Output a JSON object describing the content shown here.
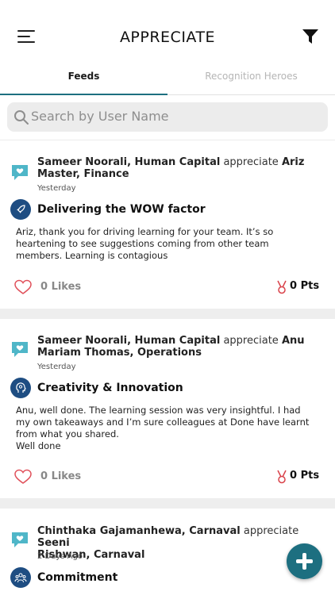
{
  "header": {
    "title": "APPRECIATE",
    "menu_icon": "hamburger-menu-icon",
    "filter_icon": "filter-funnel-icon"
  },
  "tabs": [
    {
      "label": "Feeds",
      "active": true
    },
    {
      "label": "Recognition Heroes",
      "active": false
    }
  ],
  "search": {
    "placeholder": "Search by User Name",
    "value": ""
  },
  "colors": {
    "accent": "#1d6f80",
    "badge": "#1e4d82",
    "message_icon": "#4fb6c8",
    "heart": "#e0505a",
    "medal": "#d9424a"
  },
  "feeds": [
    {
      "from": "Sameer Noorali, Human Capital",
      "verb": "appreciate",
      "to": "Ariz Master, Finance",
      "to_line1": "Ariz",
      "to_line2": "Master, Finance",
      "time": "Yesterday",
      "award": "Delivering the WOW factor",
      "award_icon": "rocket-icon",
      "message": "Ariz, thank you for driving learning for your team. It’s so heartening to see suggestions coming from other team members. Learning is contagious",
      "likes": "0 Likes",
      "points": "0 Pts"
    },
    {
      "from": "Sameer Noorali, Human Capital",
      "verb": "appreciate",
      "to": "Anu Mariam Thomas, Operations",
      "to_line1": "Anu",
      "to_line2": "Mariam Thomas, Operations",
      "time": "Yesterday",
      "award": "Creativity & Innovation",
      "award_icon": "head-idea-icon",
      "message": "Anu, well done. The learning session was very insightful. I had my own takeaways and I’m sure colleagues at Done have learnt from what you shared.\nWell done",
      "likes": "0 Likes",
      "points": "0 Pts"
    },
    {
      "from": "Chinthaka Gajamanhewa, Carnaval",
      "verb": "appreciate",
      "to": "Seeni Rishwan, Carnaval",
      "to_line1": "Seeni",
      "to_line2": "Rishwan, Carnaval",
      "time": "2 Days Ago",
      "award": "Commitment",
      "award_icon": "team-people-icon"
    }
  ],
  "fab": {
    "icon": "plus-icon"
  }
}
